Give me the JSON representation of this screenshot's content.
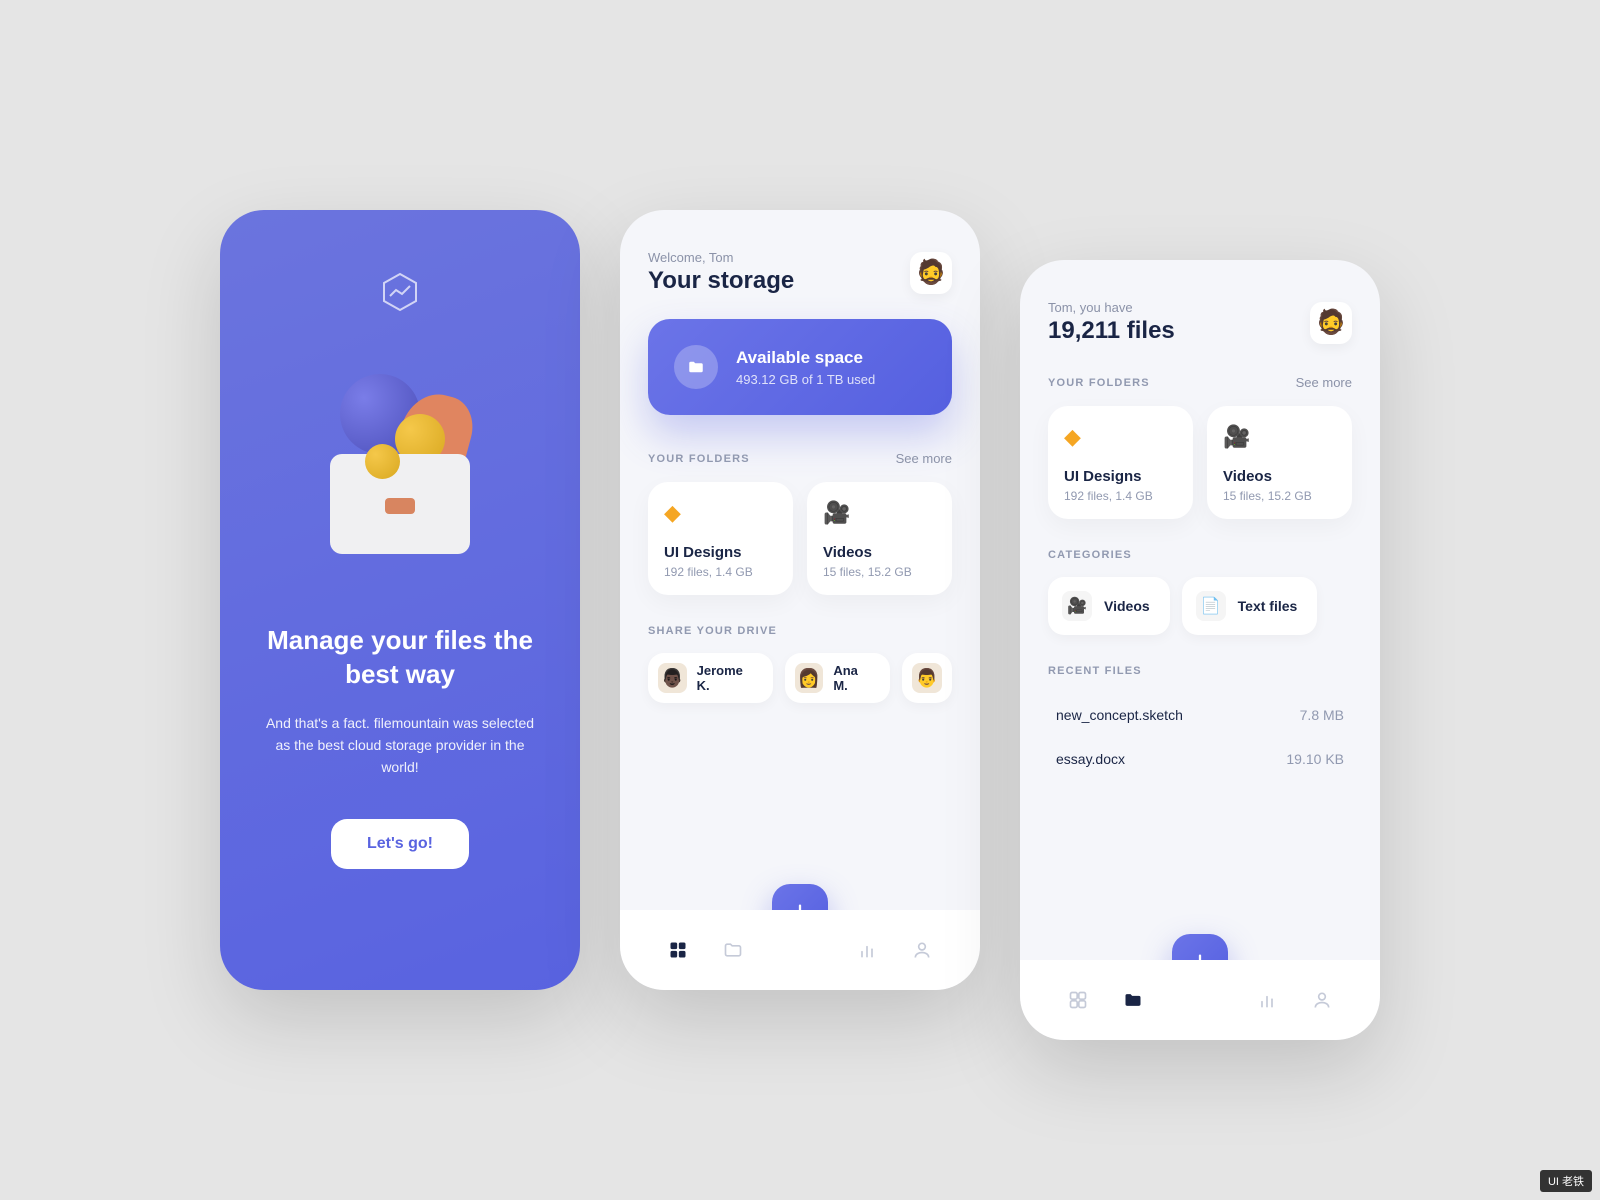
{
  "onboarding": {
    "heading": "Manage your files the best way",
    "subtext": "And that's a fact. filemountain was selected as the best cloud storage provider in the world!",
    "cta": "Let's go!"
  },
  "screen2": {
    "greeting": "Welcome, Tom",
    "title": "Your storage",
    "space": {
      "title": "Available space",
      "subtitle": "493.12 GB of 1 TB used"
    },
    "folders_label": "YOUR FOLDERS",
    "see_more": "See more",
    "folders": [
      {
        "icon": "💎",
        "name": "UI Designs",
        "meta": "192 files, 1.4 GB"
      },
      {
        "icon": "🎥",
        "name": "Videos",
        "meta": "15 files, 15.2 GB"
      }
    ],
    "share_label": "SHARE YOUR DRIVE",
    "contacts": [
      {
        "emoji": "👨🏿",
        "name": "Jerome K."
      },
      {
        "emoji": "👩",
        "name": "Ana M."
      }
    ]
  },
  "screen3": {
    "greeting": "Tom, you have",
    "title": "19,211 files",
    "folders_label": "YOUR FOLDERS",
    "see_more": "See more",
    "folders": [
      {
        "icon": "💎",
        "name": "UI Designs",
        "meta": "192 files, 1.4 GB"
      },
      {
        "icon": "🎥",
        "name": "Videos",
        "meta": "15 files, 15.2 GB"
      }
    ],
    "categories_label": "CATEGORIES",
    "categories": [
      {
        "icon": "🎥",
        "name": "Videos"
      },
      {
        "icon": "📄",
        "name": "Text files"
      }
    ],
    "recent_label": "RECENT FILES",
    "recent": [
      {
        "name": "new_concept.sketch",
        "size": "7.8 MB"
      },
      {
        "name": "essay.docx",
        "size": "19.10 KB"
      }
    ]
  },
  "watermark": "UI 老铁"
}
